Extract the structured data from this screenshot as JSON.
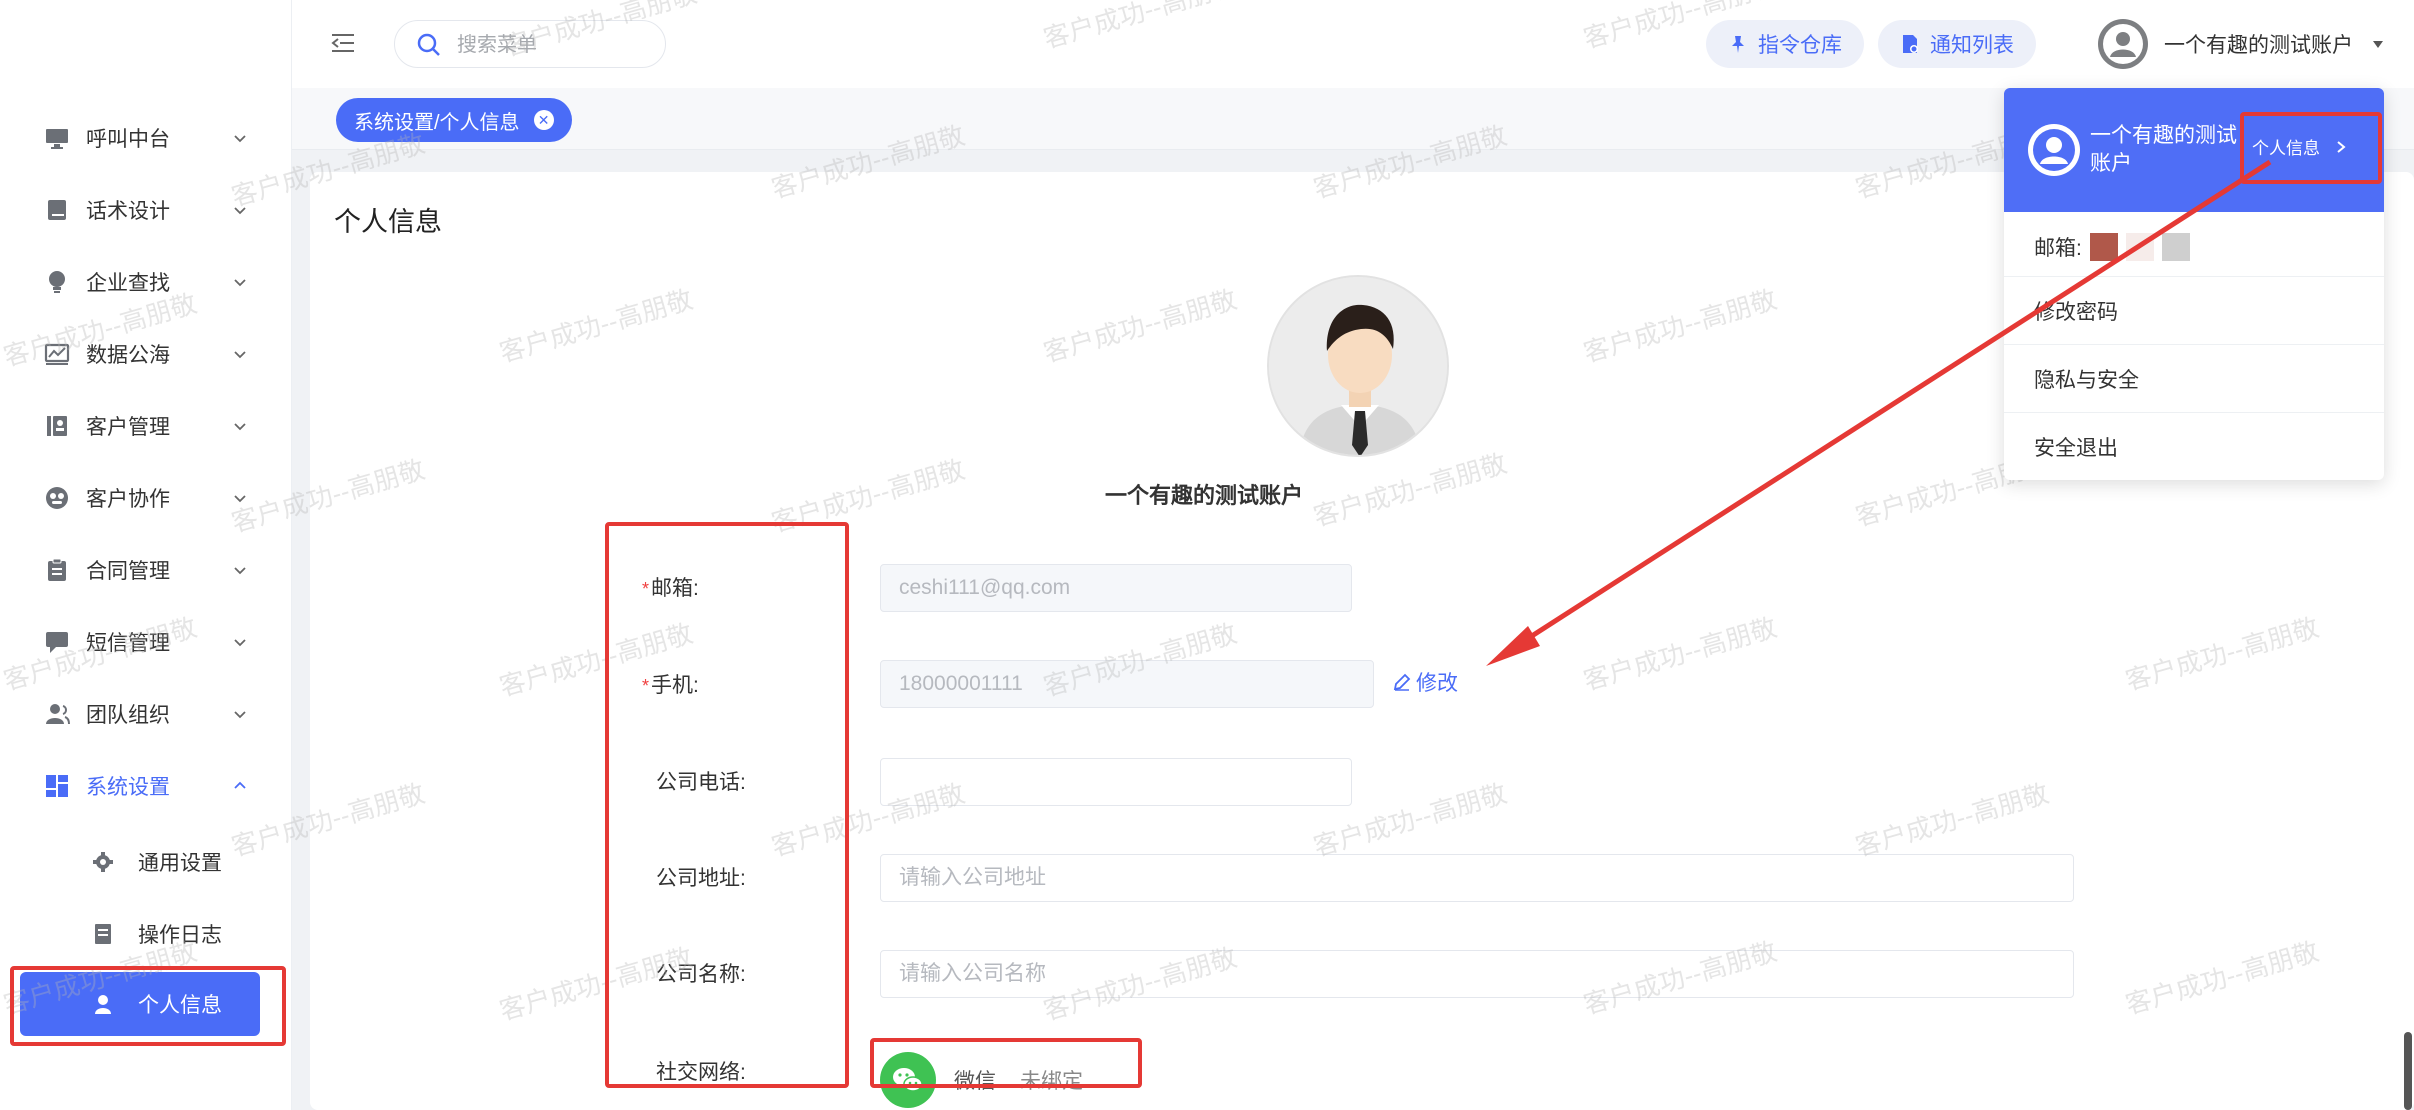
{
  "sidebar": {
    "items": [
      {
        "label": "呼叫中台",
        "icon": "monitor-icon"
      },
      {
        "label": "话术设计",
        "icon": "book-icon"
      },
      {
        "label": "企业查找",
        "icon": "lightbulb-icon"
      },
      {
        "label": "数据公海",
        "icon": "chart-area-icon"
      },
      {
        "label": "客户管理",
        "icon": "contact-book-icon"
      },
      {
        "label": "客户协作",
        "icon": "collaboration-icon"
      },
      {
        "label": "合同管理",
        "icon": "clipboard-icon"
      },
      {
        "label": "短信管理",
        "icon": "message-icon"
      },
      {
        "label": "团队组织",
        "icon": "team-icon"
      },
      {
        "label": "系统设置",
        "icon": "grid-icon"
      }
    ],
    "sub_items": [
      {
        "label": "通用设置",
        "icon": "gear-icon"
      },
      {
        "label": "操作日志",
        "icon": "document-icon"
      },
      {
        "label": "个人信息",
        "icon": "user-icon"
      }
    ]
  },
  "header": {
    "search_placeholder": "搜索菜单",
    "commands_label": "指令仓库",
    "notifications_label": "通知列表",
    "username": "一个有趣的测试账户"
  },
  "tabs": [
    {
      "label": "系统设置/个人信息"
    }
  ],
  "page": {
    "title": "个人信息",
    "display_name": "一个有趣的测试账户",
    "form": {
      "email_label": "邮箱:",
      "email_value": "ceshi111@qq.com",
      "phone_label": "手机:",
      "phone_value": "18000001111",
      "edit_label": "修改",
      "company_phone_label": "公司电话:",
      "company_phone_value": "",
      "company_address_label": "公司地址:",
      "company_address_placeholder": "请输入公司地址",
      "company_name_label": "公司名称:",
      "company_name_placeholder": "请输入公司名称",
      "social_label": "社交网络:",
      "wechat_label": "微信",
      "wechat_status": "未绑定"
    }
  },
  "dropdown": {
    "name": "一个有趣的测试账户",
    "profile_link": "个人信息",
    "email_label": "邮箱:",
    "change_password": "修改密码",
    "privacy": "隐私与安全",
    "logout": "安全退出"
  },
  "watermark_text": "客户成功--高朋敬",
  "colors": {
    "accent": "#4a6cf7",
    "annotation": "#e53935",
    "wechat": "#3fc253"
  }
}
